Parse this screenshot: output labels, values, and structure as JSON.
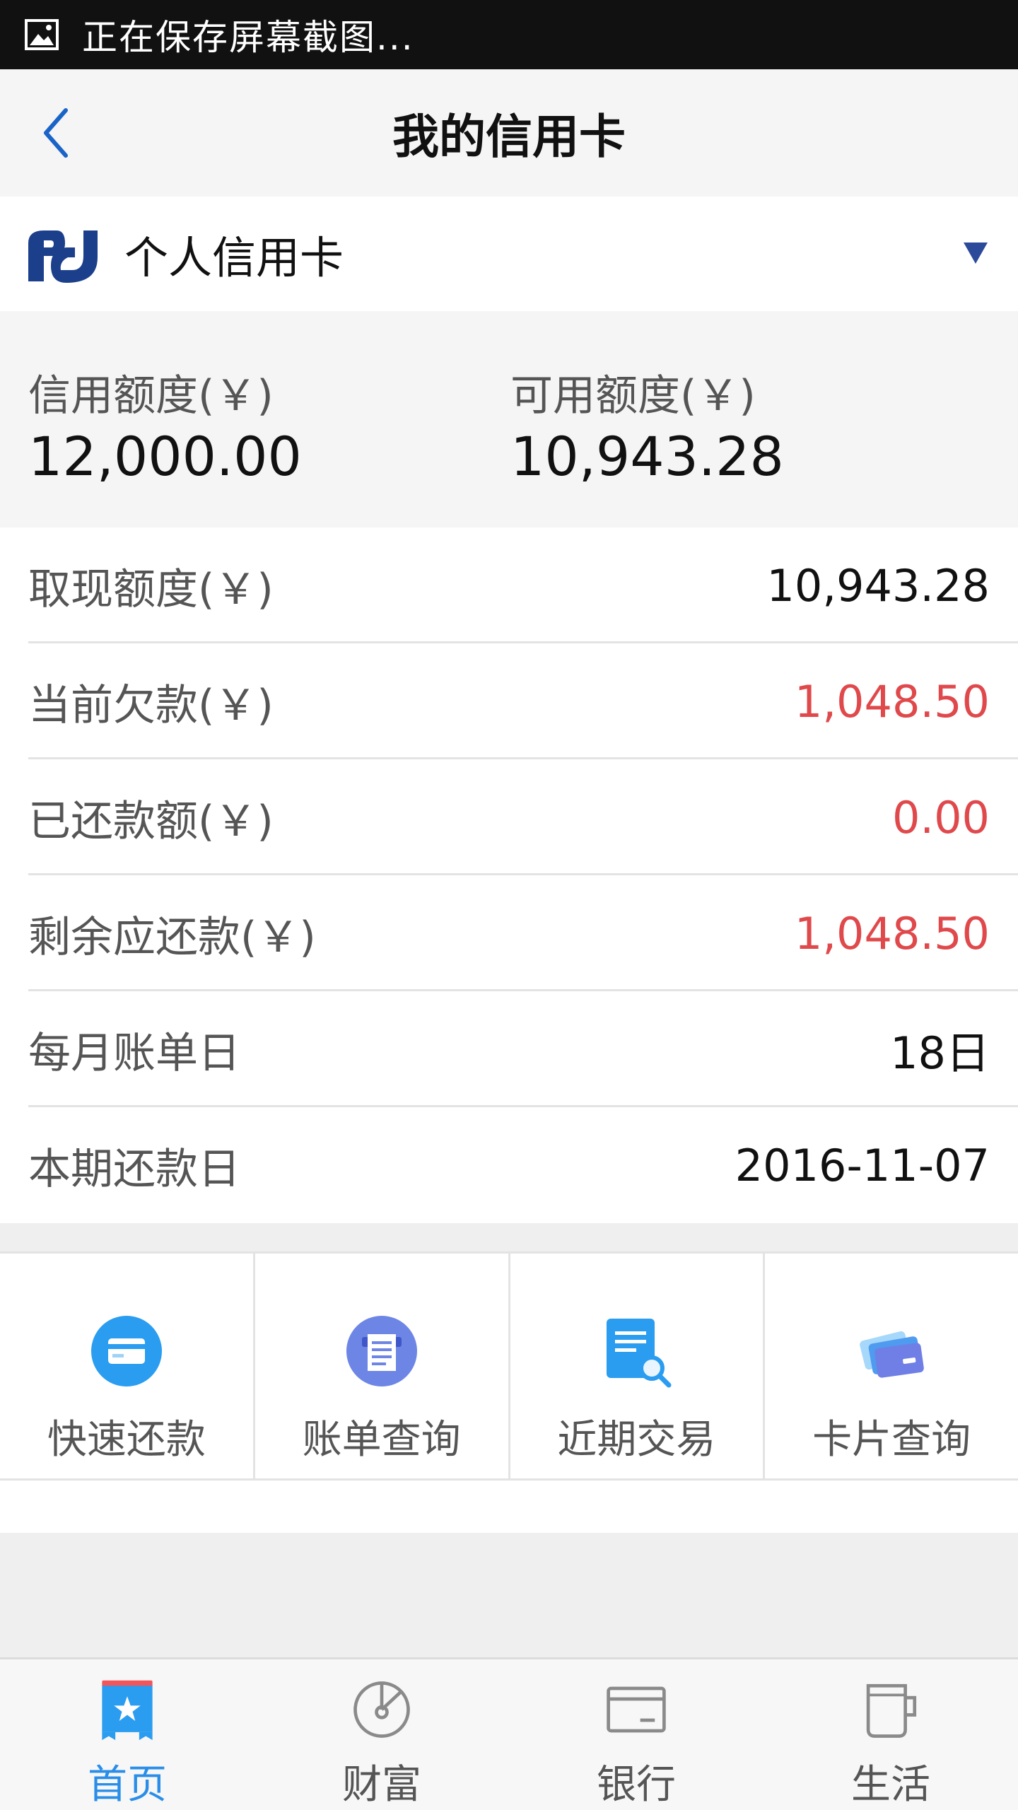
{
  "status_bar": {
    "text": "正在保存屏幕截图..."
  },
  "nav": {
    "title": "我的信用卡"
  },
  "card_selector": {
    "card_name": "个人信用卡"
  },
  "summary": {
    "credit_limit_label": "信用额度(￥)",
    "credit_limit_value": "12,000.00",
    "available_limit_label": "可用额度(￥)",
    "available_limit_value": "10,943.28"
  },
  "details": [
    {
      "label": "取现额度(￥)",
      "value": "10,943.28",
      "highlight": false
    },
    {
      "label": "当前欠款(￥)",
      "value": "1,048.50",
      "highlight": true
    },
    {
      "label": "已还款额(￥)",
      "value": "0.00",
      "highlight": true
    },
    {
      "label": "剩余应还款(￥)",
      "value": "1,048.50",
      "highlight": true
    },
    {
      "label": "每月账单日",
      "value": "18日",
      "highlight": false
    },
    {
      "label": "本期还款日",
      "value": "2016-11-07",
      "highlight": false
    }
  ],
  "actions": [
    {
      "label": "快速还款",
      "icon": "card-circle-icon"
    },
    {
      "label": "账单查询",
      "icon": "bill-circle-icon"
    },
    {
      "label": "近期交易",
      "icon": "document-search-icon"
    },
    {
      "label": "卡片查询",
      "icon": "cards-stack-icon"
    }
  ],
  "tabs": [
    {
      "label": "首页",
      "icon": "home-star-icon",
      "active": true
    },
    {
      "label": "财富",
      "icon": "wealth-pie-icon",
      "active": false
    },
    {
      "label": "银行",
      "icon": "bank-card-icon",
      "active": false
    },
    {
      "label": "生活",
      "icon": "cup-icon",
      "active": false
    }
  ],
  "colors": {
    "accent_blue": "#2a8ee8",
    "highlight_red": "#e0494c",
    "brand_navy": "#1c3f8c"
  }
}
